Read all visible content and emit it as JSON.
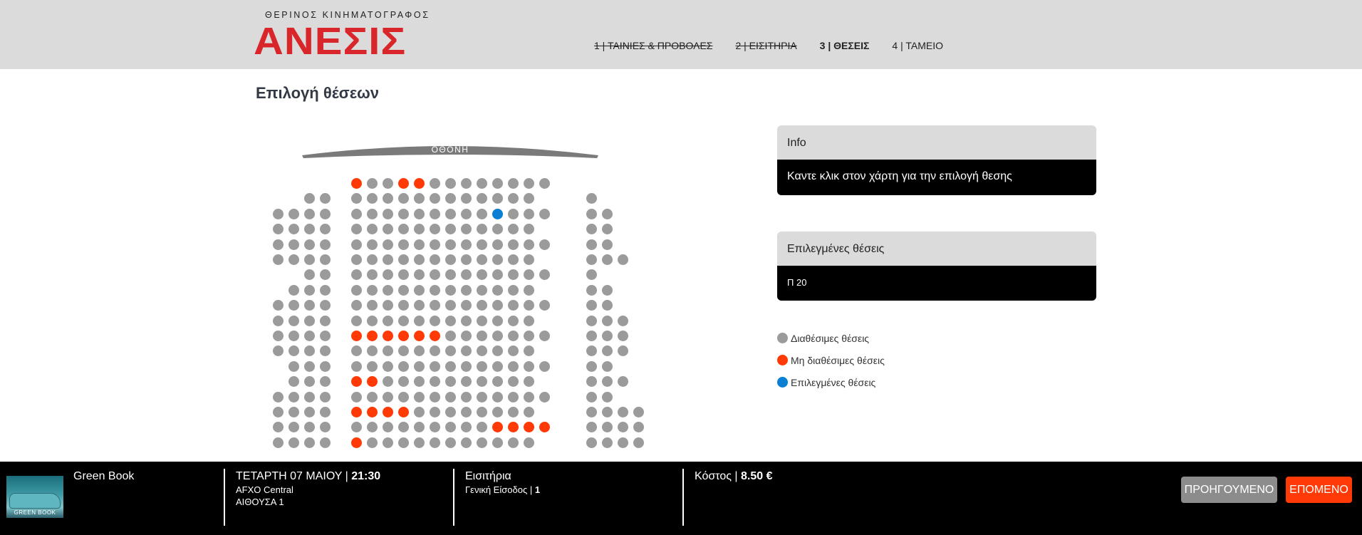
{
  "header": {
    "logo_subtitle": "ΘΕΡΙΝΟΣ ΚΙΝΗΜΑΤΟΓΡΑΦΟΣ",
    "logo_title": "ΑΝΕΣΙΣ",
    "steps": [
      {
        "label": "1 | ΤΑΙΝΙΕΣ & ΠΡΟΒΟΛΕΣ",
        "state": "done"
      },
      {
        "label": "2 | ΕΙΣΙΤΗΡΙΑ",
        "state": "done"
      },
      {
        "label": "3 | ΘΕΣΕΙΣ",
        "state": "current"
      },
      {
        "label": "4 | ΤΑΜΕΙΟ",
        "state": "pending"
      }
    ]
  },
  "page_title": "Επιλογή θέσεων",
  "seatmap": {
    "screen_label": "ΟΘΟΝΗ",
    "seat_states": {
      "0": {
        "c": [
          5,
          6,
          7,
          8,
          9,
          10,
          11,
          12,
          13,
          14,
          15,
          16,
          17
        ],
        "u": [
          5,
          8,
          9
        ]
      },
      "1": {
        "c": [
          2,
          3,
          5,
          6,
          7,
          8,
          9,
          10,
          11,
          12,
          13,
          14,
          15,
          16,
          20
        ]
      },
      "2": {
        "c": [
          0,
          1,
          2,
          3,
          5,
          6,
          7,
          8,
          9,
          10,
          11,
          12,
          13,
          14,
          15,
          16,
          17,
          20,
          21
        ],
        "s": [
          14
        ]
      },
      "3": {
        "c": [
          0,
          1,
          2,
          3,
          5,
          6,
          7,
          8,
          9,
          10,
          11,
          12,
          13,
          14,
          15,
          16,
          20,
          21
        ]
      },
      "4": {
        "c": [
          0,
          1,
          2,
          3,
          5,
          6,
          7,
          8,
          9,
          10,
          11,
          12,
          13,
          14,
          15,
          16,
          17,
          20,
          21
        ]
      },
      "5": {
        "c": [
          0,
          1,
          2,
          3,
          5,
          6,
          7,
          8,
          9,
          10,
          11,
          12,
          13,
          14,
          15,
          16,
          20,
          21,
          22
        ]
      },
      "6": {
        "c": [
          2,
          3,
          5,
          6,
          7,
          8,
          9,
          10,
          11,
          12,
          13,
          14,
          15,
          16,
          17,
          20
        ]
      },
      "7": {
        "c": [
          1,
          2,
          3,
          5,
          6,
          7,
          8,
          9,
          10,
          11,
          12,
          13,
          14,
          15,
          16,
          20,
          21
        ]
      },
      "8": {
        "c": [
          0,
          1,
          2,
          3,
          5,
          6,
          7,
          8,
          9,
          10,
          11,
          12,
          13,
          14,
          15,
          16,
          17,
          20,
          21
        ]
      },
      "9": {
        "c": [
          0,
          1,
          2,
          3,
          5,
          6,
          7,
          8,
          9,
          10,
          11,
          12,
          13,
          14,
          15,
          16,
          20,
          21,
          22
        ]
      },
      "10": {
        "c": [
          0,
          1,
          2,
          3,
          5,
          6,
          7,
          8,
          9,
          10,
          11,
          12,
          13,
          14,
          15,
          16,
          17,
          20,
          21,
          22
        ],
        "u": [
          5,
          6,
          7,
          8,
          9,
          10
        ]
      },
      "11": {
        "c": [
          0,
          1,
          2,
          3,
          5,
          6,
          7,
          8,
          9,
          10,
          11,
          12,
          13,
          14,
          15,
          16,
          20,
          21,
          22
        ]
      },
      "12": {
        "c": [
          1,
          2,
          3,
          5,
          6,
          7,
          8,
          9,
          10,
          11,
          12,
          13,
          14,
          15,
          16,
          17,
          20,
          21
        ]
      },
      "13": {
        "c": [
          1,
          2,
          3,
          5,
          6,
          7,
          8,
          9,
          10,
          11,
          12,
          13,
          14,
          15,
          16,
          20,
          21,
          22
        ],
        "u": [
          5,
          6
        ]
      },
      "14": {
        "c": [
          0,
          1,
          2,
          3,
          5,
          6,
          7,
          8,
          9,
          10,
          11,
          12,
          13,
          14,
          15,
          16,
          17,
          20,
          21
        ]
      },
      "15": {
        "c": [
          0,
          1,
          2,
          3,
          5,
          6,
          7,
          8,
          9,
          10,
          11,
          12,
          13,
          14,
          15,
          16,
          20,
          21,
          22,
          23
        ],
        "u": [
          5,
          6,
          7,
          8
        ]
      },
      "16": {
        "c": [
          0,
          1,
          2,
          3,
          5,
          6,
          7,
          8,
          9,
          10,
          11,
          12,
          13,
          14,
          15,
          16,
          17,
          20,
          21,
          22,
          23
        ],
        "u": [
          14,
          15,
          16,
          17
        ]
      },
      "17": {
        "c": [
          0,
          1,
          2,
          3,
          5,
          6,
          7,
          8,
          9,
          10,
          11,
          12,
          13,
          14,
          15,
          16,
          20,
          21,
          22,
          23
        ],
        "u": [
          5
        ]
      }
    }
  },
  "info_panel": {
    "title": "Info",
    "body": "Καντε κλικ στον χάρτη για την επιλογή θεσης"
  },
  "selected_panel": {
    "title": "Επιλεγμένες θέσεις",
    "seats": "Π 20"
  },
  "legend": [
    {
      "label": "Διαθέσιμες θέσεις",
      "color": "#9b9b9b"
    },
    {
      "label": "Μη διαθέσιμες θέσεις",
      "color": "#ff3a06"
    },
    {
      "label": "Επιλεγμένες θέσεις",
      "color": "#0a7fd3"
    }
  ],
  "footer": {
    "poster_text": "GREEN BOOK",
    "movie_title": "Green Book",
    "date_text": "ΤΕΤΑΡΤΗ 07 ΜΑΙΟΥ | ",
    "time": "21:30",
    "cinema": "AFXO Central",
    "hall": "ΑΙΘΟΥΣΑ 1",
    "tickets_label": "Εισιτήρια",
    "ticket_type": "Γενική Είσοδος | ",
    "ticket_count": "1",
    "cost_label": "Κόστος | ",
    "cost_value": "8.50 €",
    "prev_button": "ΠΡΟΗΓΟΥΜΕΝΟ",
    "next_button": "ΕΠΟΜΕΝΟ"
  },
  "colors": {
    "available": "#9b9b9b",
    "unavailable": "#ff3a06",
    "selected": "#0a7fd3",
    "brand": "#d9262a"
  }
}
